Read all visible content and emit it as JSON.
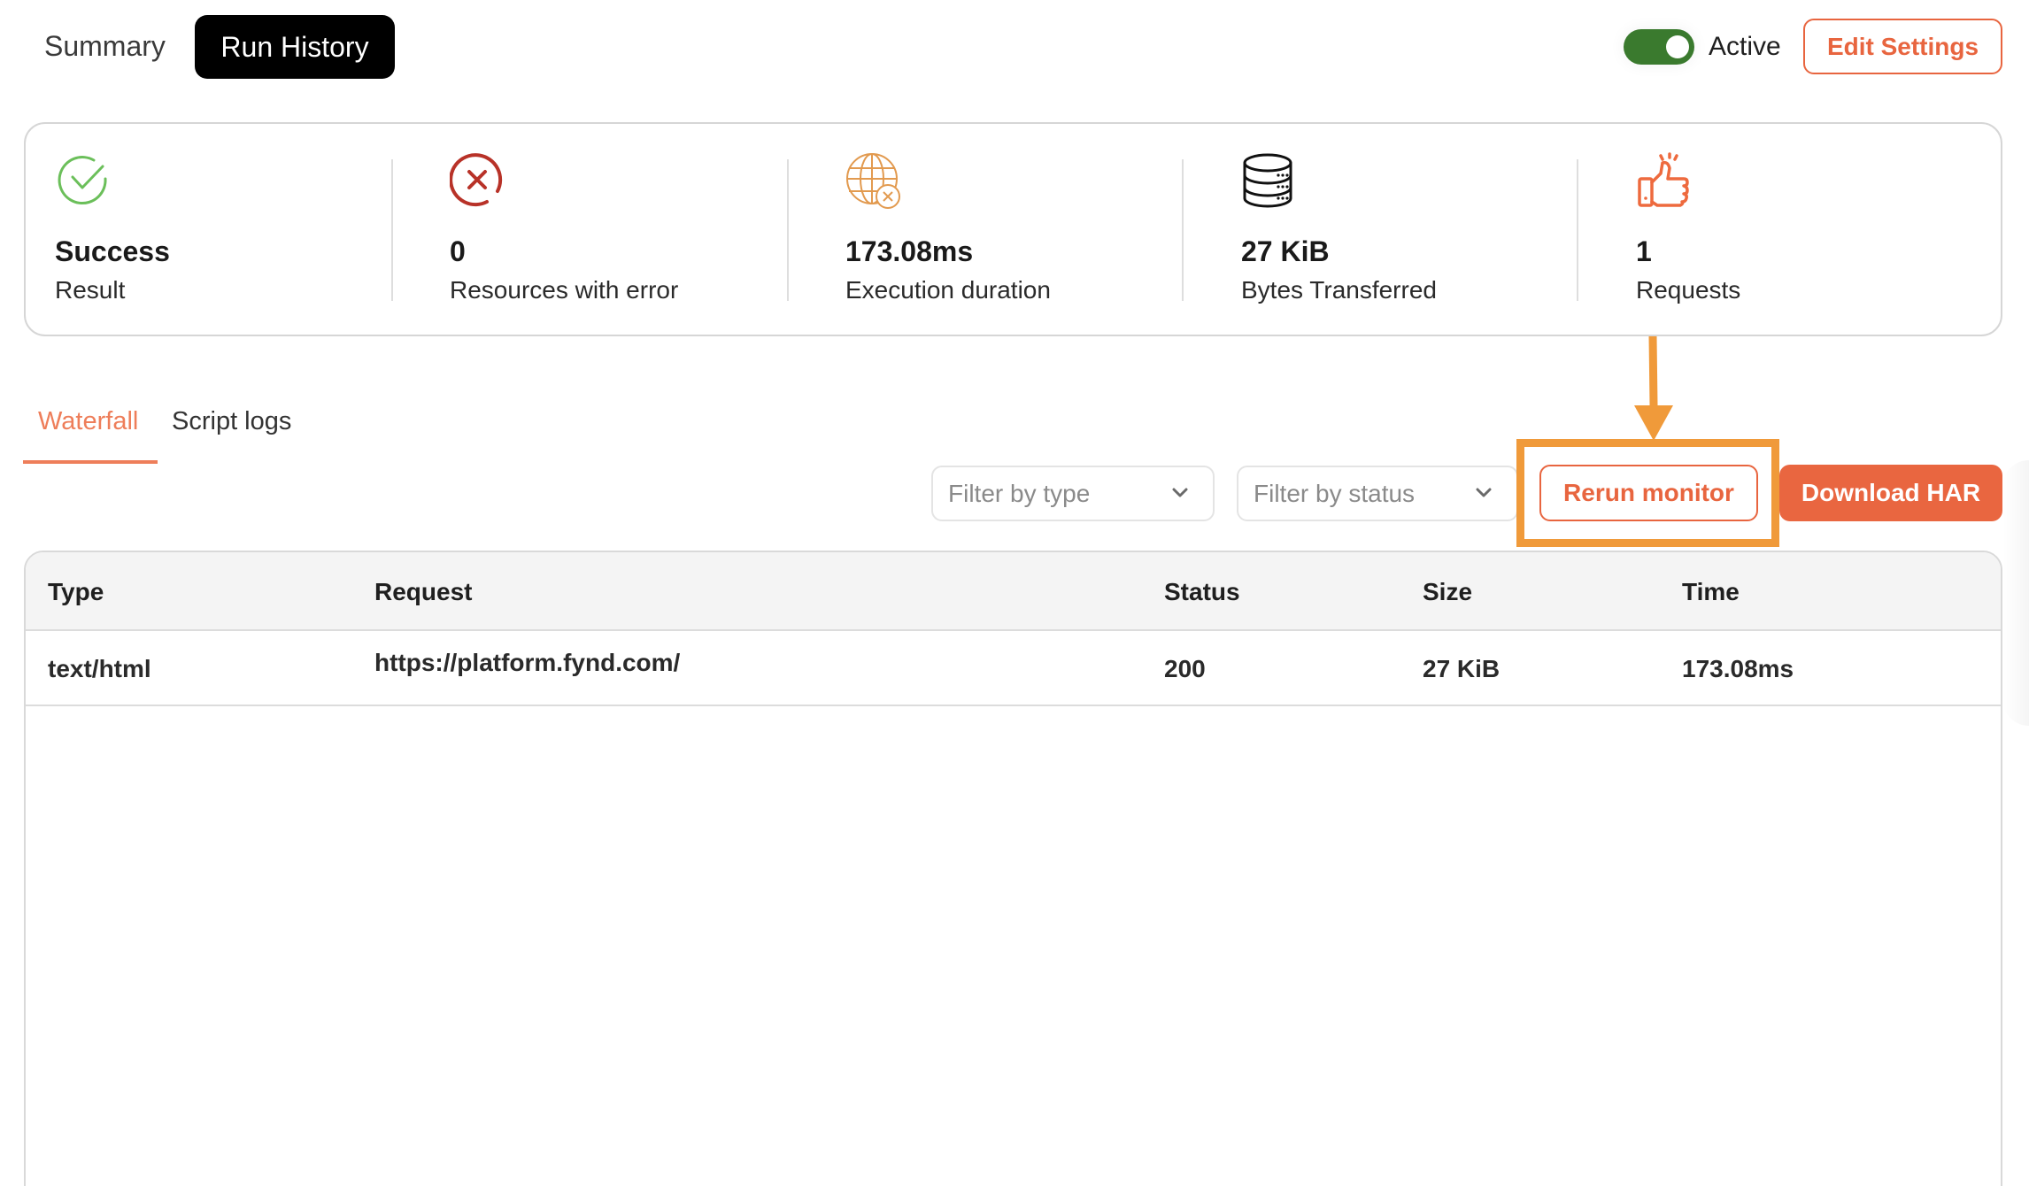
{
  "header": {
    "tabs": [
      {
        "label": "Summary",
        "active": false
      },
      {
        "label": "Run History",
        "active": true
      }
    ],
    "toggle": {
      "label": "Active",
      "on": true
    },
    "edit_settings_label": "Edit Settings"
  },
  "stats": [
    {
      "icon": "check-circle-icon",
      "value": "Success",
      "label": "Result",
      "color": "#6bbf5a"
    },
    {
      "icon": "x-circle-icon",
      "value": "0",
      "label": "Resources with error",
      "color": "#b83228"
    },
    {
      "icon": "globe-error-icon",
      "value": "173.08ms",
      "label": "Execution duration",
      "color": "#e29a4f"
    },
    {
      "icon": "database-icon",
      "value": "27 KiB",
      "label": "Bytes Transferred",
      "color": "#111111"
    },
    {
      "icon": "thumbs-up-icon",
      "value": "1",
      "label": "Requests",
      "color": "#ee6a3e"
    }
  ],
  "subtabs": [
    {
      "label": "Waterfall",
      "active": true
    },
    {
      "label": "Script logs",
      "active": false
    }
  ],
  "filters": {
    "type_placeholder": "Filter by type",
    "status_placeholder": "Filter by status"
  },
  "actions": {
    "rerun_label": "Rerun monitor",
    "download_label": "Download HAR"
  },
  "table": {
    "columns": [
      "Type",
      "Request",
      "Status",
      "Size",
      "Time"
    ],
    "rows": [
      [
        "text/html",
        "https://platform.fynd.com/",
        "200",
        "27 KiB",
        "173.08ms"
      ]
    ]
  },
  "colors": {
    "accent": "#e8653f",
    "toggle_on": "#3a7a2e",
    "annotation": "#f09a3a"
  }
}
